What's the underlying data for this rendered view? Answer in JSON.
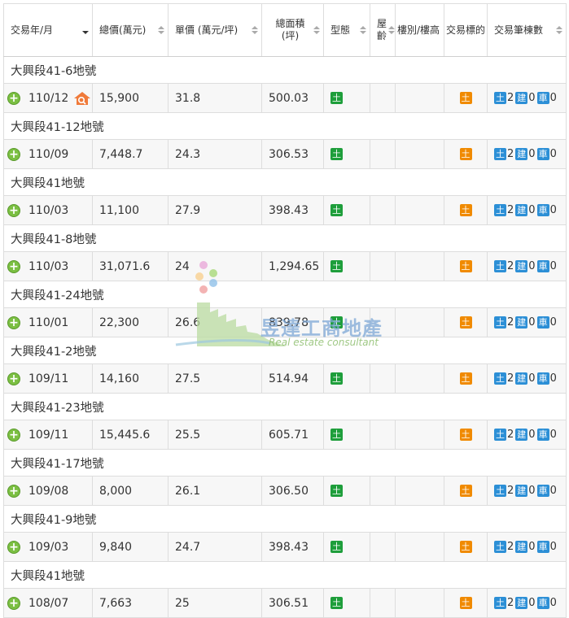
{
  "headers": [
    {
      "label": "交易年/月",
      "sort": "desc"
    },
    {
      "label": "總價(萬元)",
      "sort": "both"
    },
    {
      "label": "單價 (萬元/坪)",
      "sort": "both"
    },
    {
      "label": "總面積\n(坪)",
      "sort": "both"
    },
    {
      "label": "型態",
      "sort": "both"
    },
    {
      "label": "屋齡",
      "sort": "both"
    },
    {
      "label": "樓別/樓高",
      "sort": "none"
    },
    {
      "label": "交易標的",
      "sort": "none"
    },
    {
      "label": "交易筆棟數",
      "sort": "both"
    }
  ],
  "badges": {
    "land": "土",
    "building": "建",
    "parking": "車"
  },
  "colors": {
    "type_badge": "#1e9e3b",
    "target_badge": "#f08a00",
    "count_badge": "#2c8fd6",
    "plus": "#7bbf42",
    "house_icon": "#f07a3a"
  },
  "records": [
    {
      "address": "大興段41-6地號",
      "date": "110/12",
      "total": "15,900",
      "unit": "31.8",
      "area": "500.03",
      "age": "",
      "floor": "",
      "land": "2",
      "building": "0",
      "parking": "0",
      "house_icon": true
    },
    {
      "address": "大興段41-12地號",
      "date": "110/09",
      "total": "7,448.7",
      "unit": "24.3",
      "area": "306.53",
      "age": "",
      "floor": "",
      "land": "2",
      "building": "0",
      "parking": "0",
      "house_icon": false
    },
    {
      "address": "大興段41地號",
      "date": "110/03",
      "total": "11,100",
      "unit": "27.9",
      "area": "398.43",
      "age": "",
      "floor": "",
      "land": "2",
      "building": "0",
      "parking": "0",
      "house_icon": false
    },
    {
      "address": "大興段41-8地號",
      "date": "110/03",
      "total": "31,071.6",
      "unit": "24",
      "area": "1,294.65",
      "age": "",
      "floor": "",
      "land": "2",
      "building": "0",
      "parking": "0",
      "house_icon": false
    },
    {
      "address": "大興段41-24地號",
      "date": "110/01",
      "total": "22,300",
      "unit": "26.6",
      "area": "839.78",
      "age": "",
      "floor": "",
      "land": "2",
      "building": "0",
      "parking": "0",
      "house_icon": false
    },
    {
      "address": "大興段41-2地號",
      "date": "109/11",
      "total": "14,160",
      "unit": "27.5",
      "area": "514.94",
      "age": "",
      "floor": "",
      "land": "2",
      "building": "0",
      "parking": "0",
      "house_icon": false
    },
    {
      "address": "大興段41-23地號",
      "date": "109/11",
      "total": "15,445.6",
      "unit": "25.5",
      "area": "605.71",
      "age": "",
      "floor": "",
      "land": "2",
      "building": "0",
      "parking": "0",
      "house_icon": false
    },
    {
      "address": "大興段41-17地號",
      "date": "109/08",
      "total": "8,000",
      "unit": "26.1",
      "area": "306.50",
      "age": "",
      "floor": "",
      "land": "2",
      "building": "0",
      "parking": "0",
      "house_icon": false
    },
    {
      "address": "大興段41-9地號",
      "date": "109/03",
      "total": "9,840",
      "unit": "24.7",
      "area": "398.43",
      "age": "",
      "floor": "",
      "land": "2",
      "building": "0",
      "parking": "0",
      "house_icon": false
    },
    {
      "address": "大興段41地號",
      "date": "108/07",
      "total": "7,663",
      "unit": "25",
      "area": "306.51",
      "age": "",
      "floor": "",
      "land": "2",
      "building": "0",
      "parking": "0",
      "house_icon": false
    }
  ],
  "watermark": {
    "title": "昱達工商地產",
    "subtitle": "Real estate consultant"
  }
}
